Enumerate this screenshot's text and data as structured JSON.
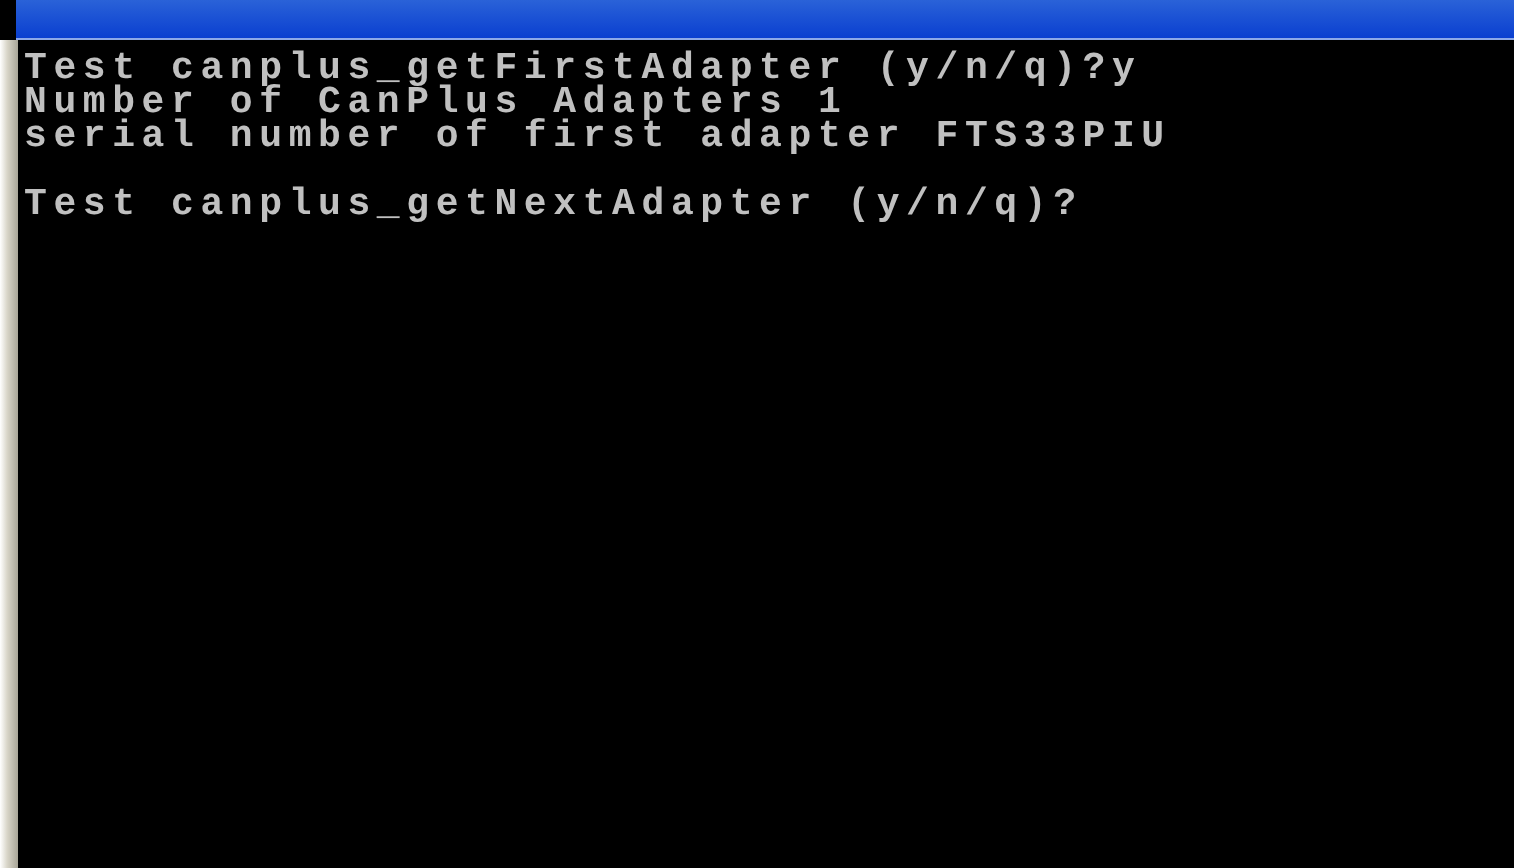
{
  "console": {
    "blocks": [
      [
        "Test canplus_getFirstAdapter (y/n/q)?y",
        "Number of CanPlus Adapters 1",
        "serial number of first adapter FTS33PIU"
      ],
      [
        "Test canplus_getNextAdapter (y/n/q)?"
      ]
    ]
  }
}
